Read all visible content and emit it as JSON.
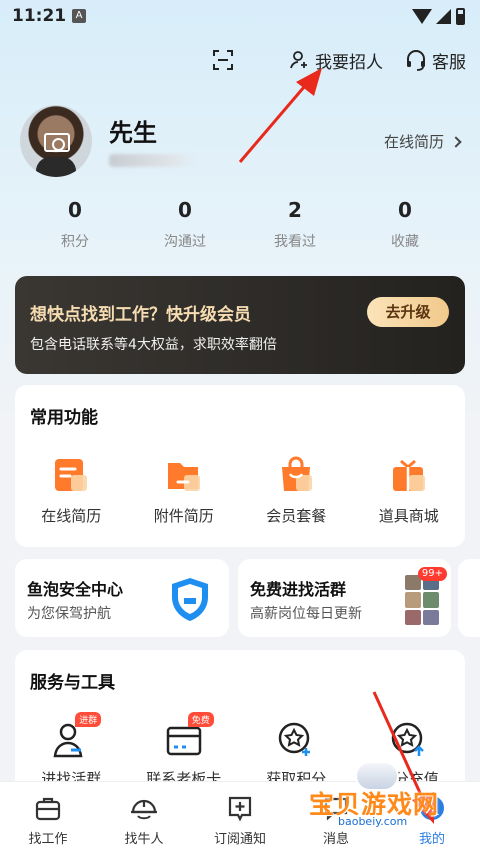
{
  "status_bar": {
    "time": "11:21",
    "notification_icon": "A"
  },
  "top_actions": {
    "scan_icon": "scan-icon",
    "recruit_label": "我要招人",
    "service_label": "客服"
  },
  "profile": {
    "name": "先生",
    "resume_link": "在线简历"
  },
  "stats": [
    {
      "value": "0",
      "label": "积分"
    },
    {
      "value": "0",
      "label": "沟通过"
    },
    {
      "value": "2",
      "label": "我看过"
    },
    {
      "value": "0",
      "label": "收藏"
    }
  ],
  "vip": {
    "title": "想快点找到工作？快升级会员",
    "subtitle": "包含电话联系等4大权益，求职效率翻倍",
    "button": "去升级"
  },
  "common_functions": {
    "title": "常用功能",
    "items": [
      {
        "label": "在线简历",
        "icon": "resume-icon"
      },
      {
        "label": "附件简历",
        "icon": "folder-icon"
      },
      {
        "label": "会员套餐",
        "icon": "bag-icon"
      },
      {
        "label": "道具商城",
        "icon": "gift-icon"
      }
    ]
  },
  "promos": {
    "left": {
      "title": "鱼泡安全中心",
      "subtitle": "为您保驾护航"
    },
    "right": {
      "title": "免费进找活群",
      "subtitle": "高薪岗位每日更新",
      "badge": "99+"
    }
  },
  "services": {
    "title": "服务与工具",
    "items": [
      {
        "label": "进找活群",
        "tag": "进群",
        "icon": "group-icon"
      },
      {
        "label": "联系老板卡",
        "tag": "免费",
        "icon": "card-icon"
      },
      {
        "label": "获取积分",
        "tag": "",
        "icon": "points-icon"
      },
      {
        "label": "积分充值",
        "tag": "",
        "icon": "recharge-icon"
      }
    ]
  },
  "tabbar": [
    {
      "label": "找工作",
      "icon": "briefcase-icon",
      "active": false
    },
    {
      "label": "找牛人",
      "icon": "helmet-icon",
      "active": false
    },
    {
      "label": "订阅通知",
      "icon": "subscribe-icon",
      "active": false
    },
    {
      "label": "消息",
      "icon": "message-icon",
      "active": false
    },
    {
      "label": "我的",
      "icon": "profile-icon",
      "active": true
    }
  ],
  "watermark": {
    "text": "宝贝游戏网",
    "url": "baobeiy.com"
  },
  "colors": {
    "accent": "#2a7de1",
    "orange": "#ff8a1a",
    "vip_gold": "#f6dcb1",
    "annotation_red": "#e8291c"
  }
}
